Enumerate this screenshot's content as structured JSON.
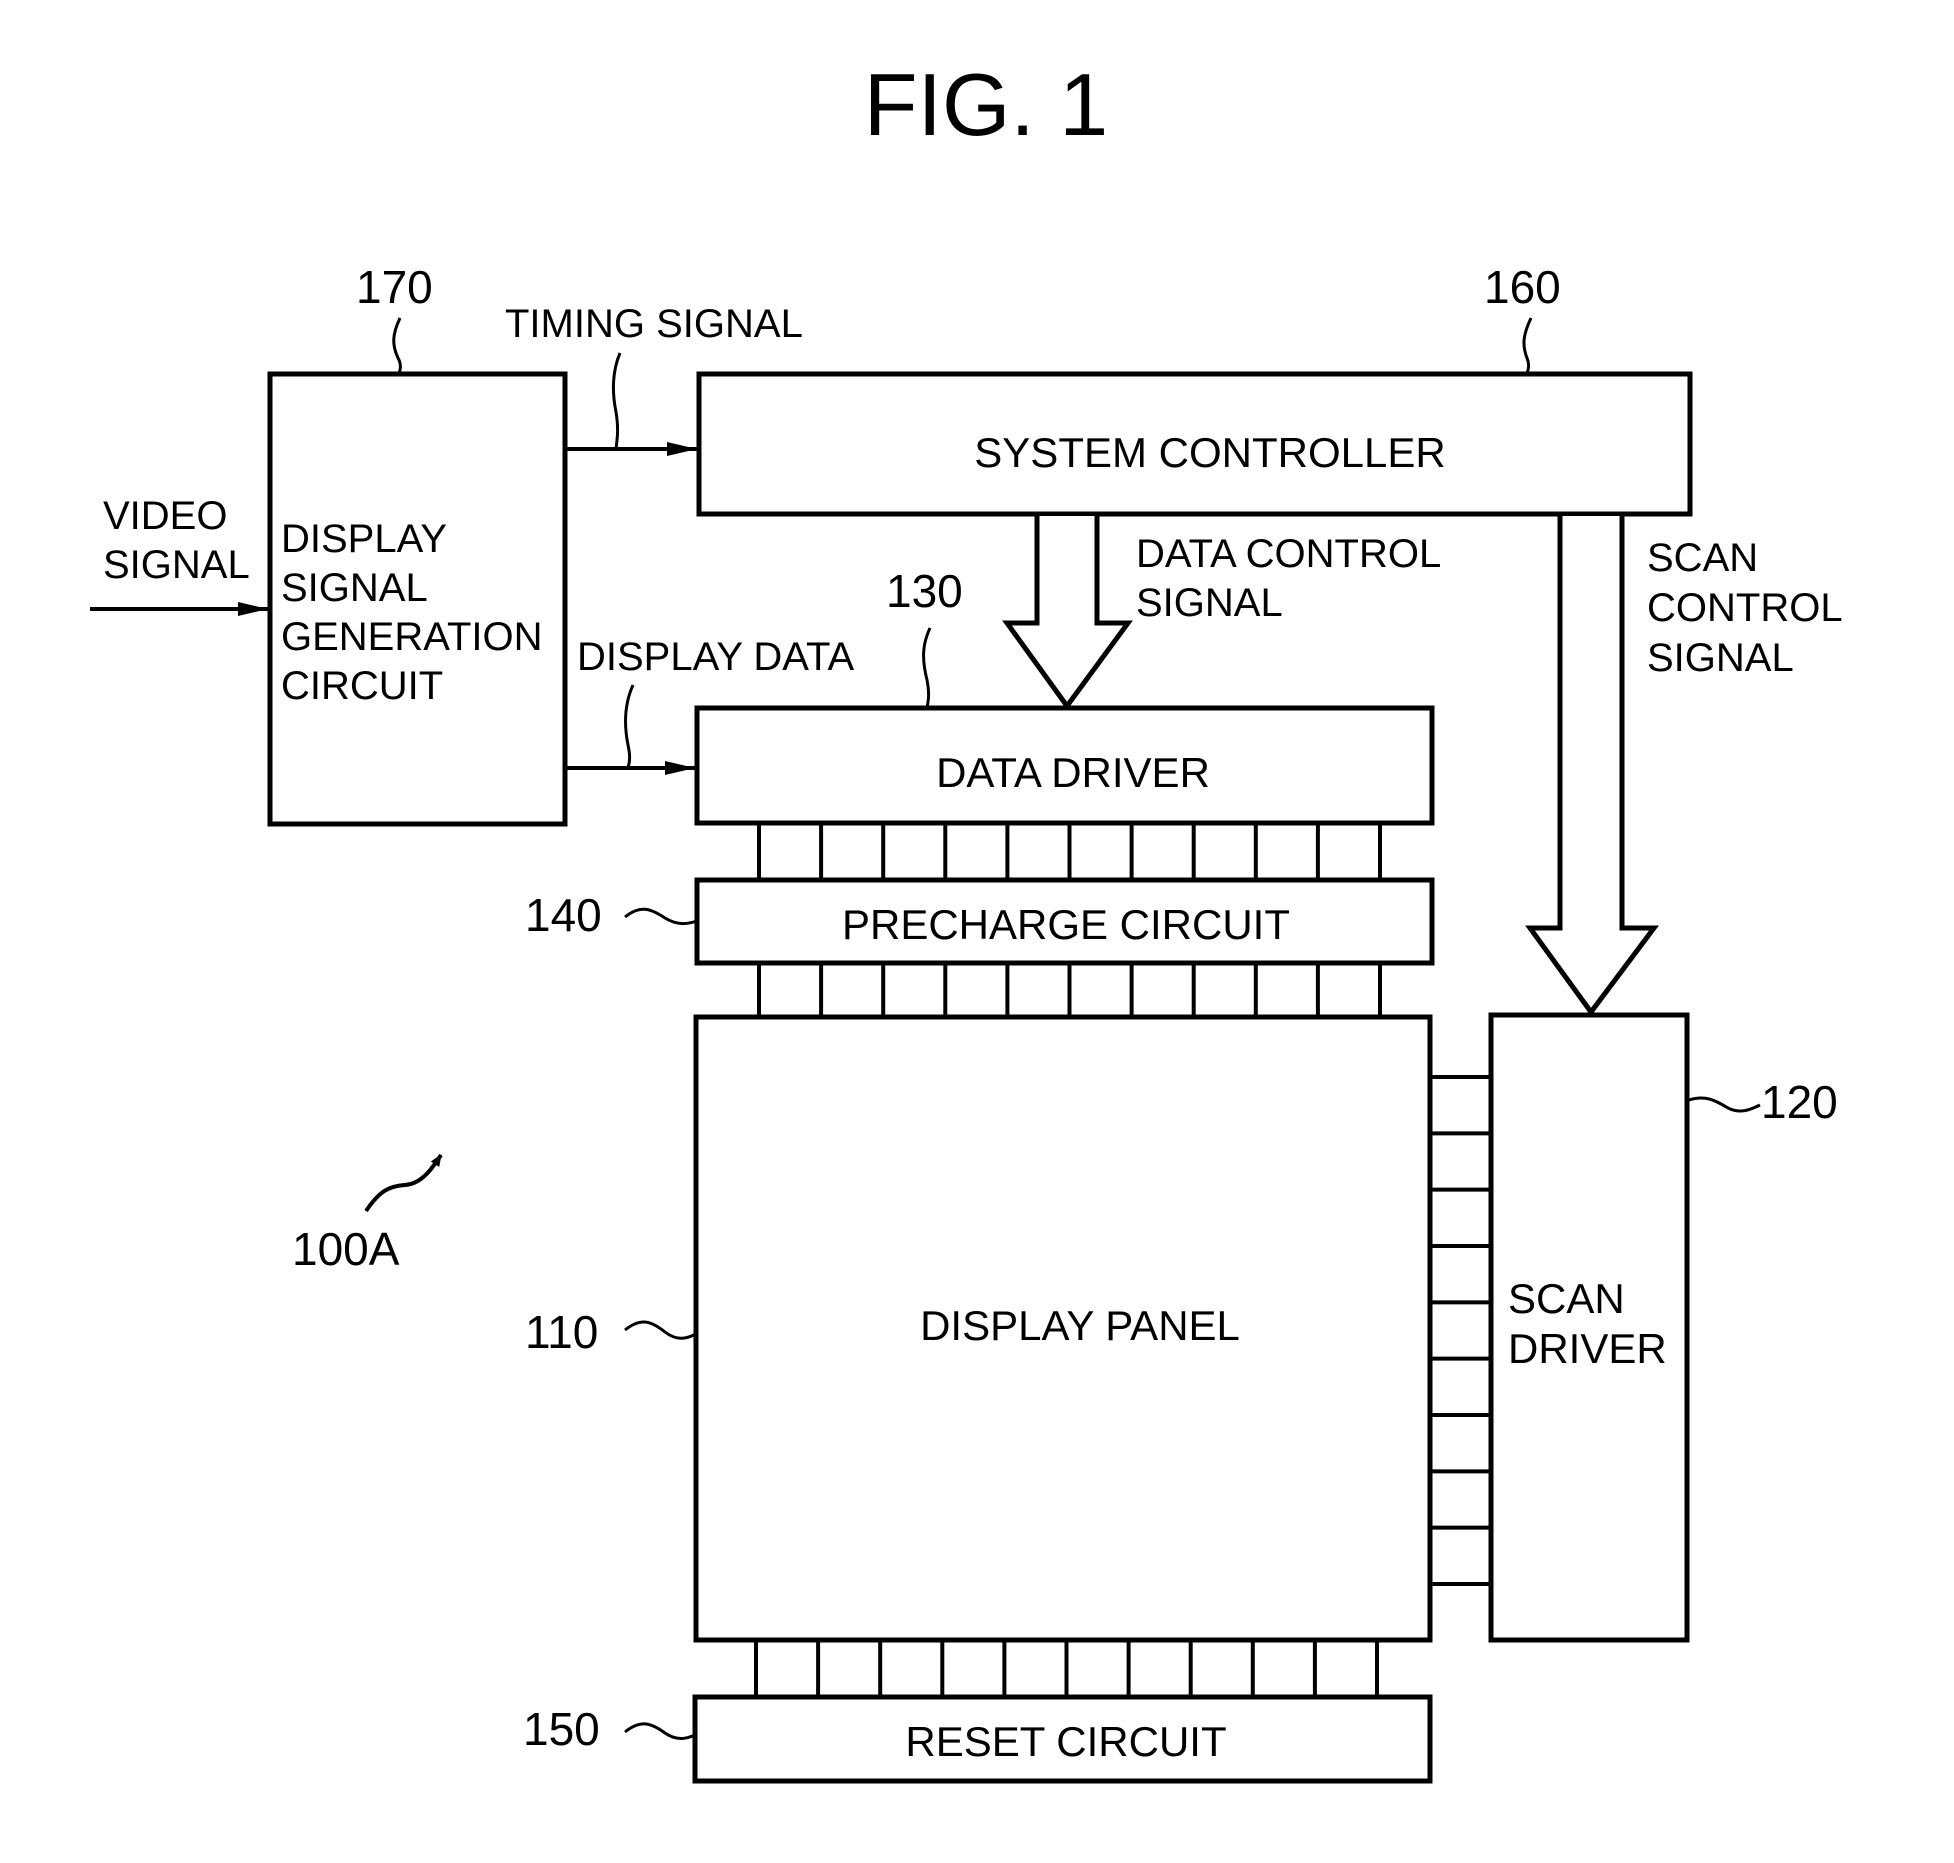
{
  "figure": {
    "title": "FIG. 1",
    "assembly_ref": "100A"
  },
  "blocks": {
    "display_signal_generation": {
      "ref": "170",
      "lines": [
        "DISPLAY",
        "SIGNAL",
        "GENERATION",
        "CIRCUIT"
      ]
    },
    "system_controller": {
      "ref": "160",
      "label": "SYSTEM CONTROLLER"
    },
    "data_driver": {
      "ref": "130",
      "label": "DATA DRIVER"
    },
    "precharge_circuit": {
      "ref": "140",
      "label": "PRECHARGE CIRCUIT"
    },
    "display_panel": {
      "ref": "110",
      "label": "DISPLAY PANEL"
    },
    "scan_driver": {
      "ref": "120",
      "lines": [
        "SCAN",
        "DRIVER"
      ]
    },
    "reset_circuit": {
      "ref": "150",
      "label": "RESET CIRCUIT"
    }
  },
  "signals": {
    "video": {
      "lines": [
        "VIDEO",
        "SIGNAL"
      ]
    },
    "timing": {
      "label": "TIMING SIGNAL"
    },
    "display_data": {
      "label": "DISPLAY DATA"
    },
    "data_control": {
      "lines": [
        "DATA CONTROL",
        "SIGNAL"
      ]
    },
    "scan_control": {
      "lines": [
        "SCAN",
        "CONTROL",
        "SIGNAL"
      ]
    }
  },
  "connectors": {
    "data_driver_to_precharge_lines": 11,
    "precharge_to_panel_lines": 11,
    "panel_to_reset_lines": 11,
    "panel_to_scan_rows": 10
  }
}
